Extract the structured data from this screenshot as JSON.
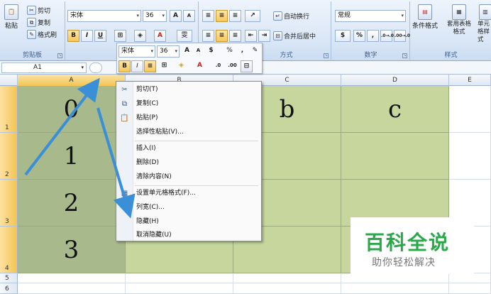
{
  "ribbon": {
    "clipboard": {
      "paste": "粘贴",
      "cut": "剪切",
      "copy": "复制",
      "format_painter": "格式刷",
      "label": "剪贴板"
    },
    "font": {
      "name": "宋体",
      "size": "36",
      "bold": "B",
      "italic": "I",
      "underline": "U",
      "grow": "A",
      "shrink": "A",
      "phonetic": "雯"
    },
    "alignment": {
      "wrap": "自动换行",
      "merge": "合并后居中",
      "label": "对齐方式",
      "label_visible": "方式"
    },
    "number": {
      "format": "常规",
      "percent": "%",
      "comma": ",",
      "inc": ".0→.00",
      "dec": ".00→.0",
      "label": "数字"
    },
    "styles": {
      "conditional": "条件格式",
      "table": "套用表格格式",
      "cell": "单元格样式",
      "label": "样式"
    }
  },
  "mini_toolbar": {
    "font": "宋体",
    "size": "36",
    "percent": "%",
    "comma": ",",
    "bold": "B",
    "italic": "I"
  },
  "formula_bar": {
    "name_box": "A1"
  },
  "columns": [
    "A",
    "B",
    "C",
    "D",
    "E"
  ],
  "rows": [
    "1",
    "2",
    "3",
    "4",
    "5",
    "6"
  ],
  "cells": {
    "a1": "0",
    "c1": "b",
    "d1": "c",
    "a2": "1",
    "a3": "2",
    "a4": "3"
  },
  "context_menu": {
    "items": [
      {
        "label": "剪切(T)",
        "icon": "scissors-icon"
      },
      {
        "label": "复制(C)",
        "icon": "copy-icon"
      },
      {
        "label": "粘贴(P)",
        "icon": "paste-icon"
      },
      {
        "label": "选择性粘贴(V)...",
        "icon": ""
      },
      {
        "label": "插入(I)",
        "icon": ""
      },
      {
        "label": "删除(D)",
        "icon": ""
      },
      {
        "label": "清除内容(N)",
        "icon": ""
      },
      {
        "label": "设置单元格格式(F)...",
        "icon": "format-cells-icon"
      },
      {
        "label": "列宽(C)...",
        "icon": ""
      },
      {
        "label": "隐藏(H)",
        "icon": ""
      },
      {
        "label": "取消隐藏(U)",
        "icon": ""
      }
    ]
  },
  "watermark": {
    "title": "百科全说",
    "subtitle": "助你轻松解决"
  },
  "colors": {
    "selection": "#a8b98c",
    "fill": "#c6d69d",
    "arrow": "#3b8fd6",
    "watermark": "#2aa84a"
  }
}
